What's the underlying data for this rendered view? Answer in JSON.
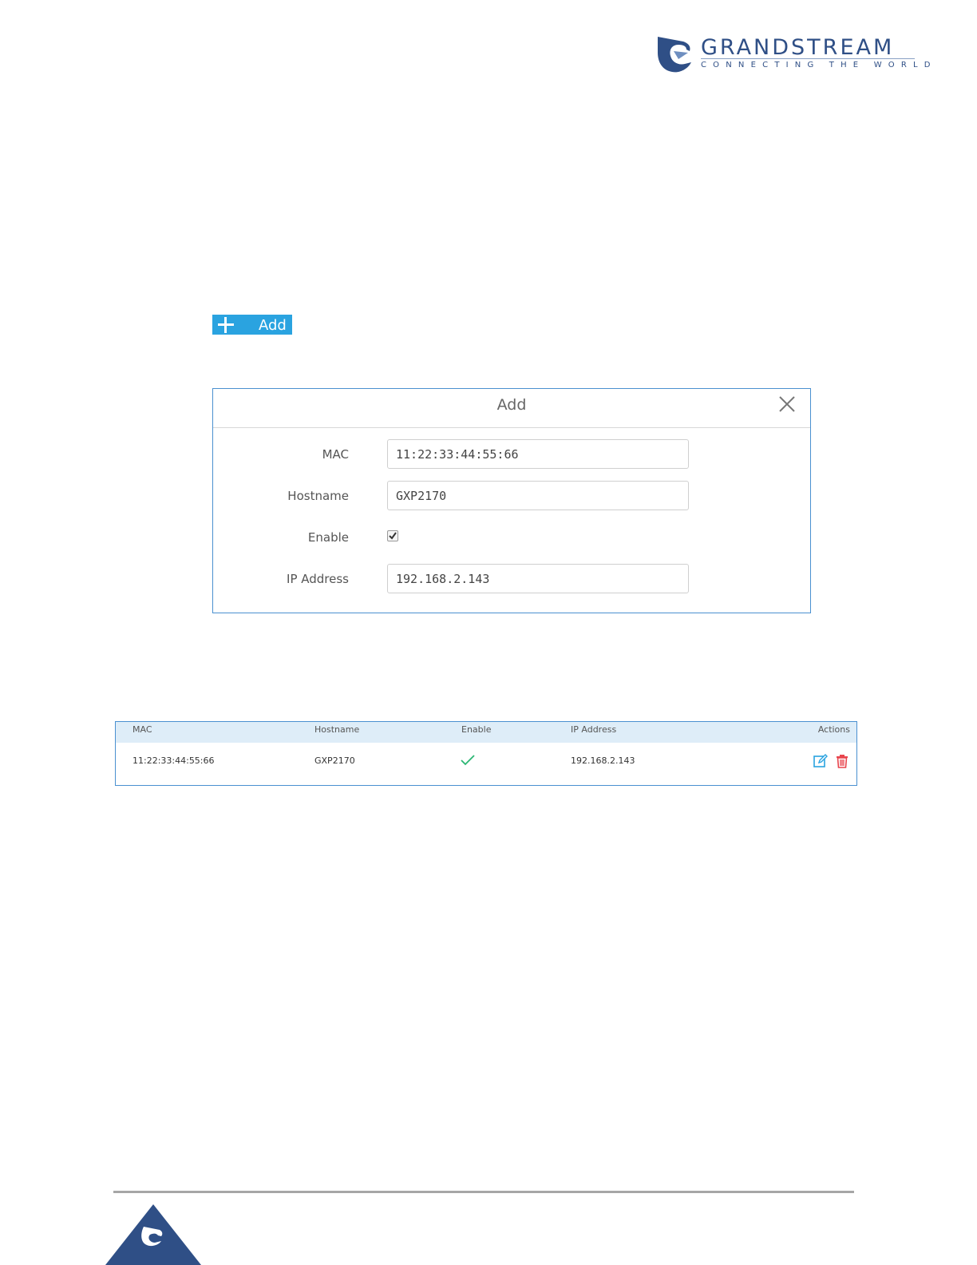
{
  "logo": {
    "name": "GRANDSTREAM",
    "tagline": "CONNECTING THE WORLD",
    "brand_color": "#2f4f86"
  },
  "add_button": {
    "label": "Add",
    "icon": "plus-icon",
    "color": "#2aa3e0"
  },
  "dialog": {
    "title": "Add",
    "close_icon": "close-icon",
    "fields": {
      "mac": {
        "label": "MAC",
        "value": "11:22:33:44:55:66"
      },
      "hostname": {
        "label": "Hostname",
        "value": "GXP2170"
      },
      "enable": {
        "label": "Enable",
        "checked": true
      },
      "ip": {
        "label": "IP Address",
        "value": "192.168.2.143"
      }
    }
  },
  "table": {
    "columns": [
      "MAC",
      "Hostname",
      "Enable",
      "IP Address",
      "Actions"
    ],
    "rows": [
      {
        "mac": "11:22:33:44:55:66",
        "hostname": "GXP2170",
        "enable": "check-icon",
        "ip": "192.168.2.143",
        "actions": [
          "edit-icon",
          "delete-icon"
        ]
      }
    ],
    "header_bg": "#deedf8",
    "edit_color": "#2aa3e0",
    "delete_color": "#e8454d",
    "check_color": "#2bb673"
  }
}
